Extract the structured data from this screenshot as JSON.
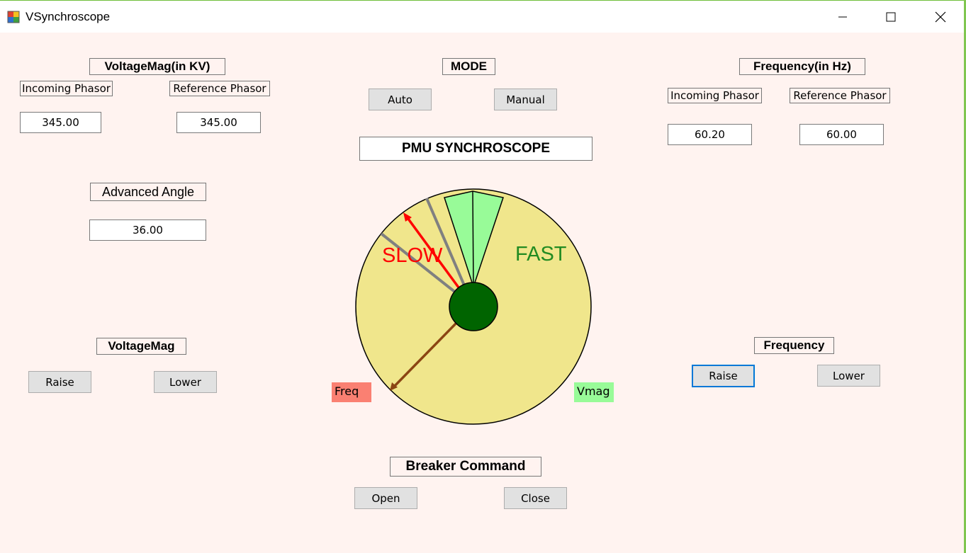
{
  "window": {
    "title": "VSynchroscope"
  },
  "voltage_mag_group": {
    "title": "VoltageMag(in KV)",
    "incoming_label": "Incoming Phasor",
    "reference_label": "Reference Phasor",
    "incoming_value": "345.00",
    "reference_value": "345.00"
  },
  "advanced_angle": {
    "label": "Advanced Angle",
    "value": "36.00"
  },
  "mode": {
    "title": "MODE",
    "auto_label": "Auto",
    "manual_label": "Manual"
  },
  "scope": {
    "title": "PMU SYNCHROSCOPE",
    "slow_label": "SLOW",
    "fast_label": "FAST",
    "freq_label": "Freq",
    "vmag_label": "Vmag",
    "colors": {
      "dial": "#f0e68c",
      "sync_window": "#98fb98",
      "hub": "#006400",
      "slow": "#ff0000",
      "fast": "#228b22",
      "freq_badge": "#fa8072",
      "vmag_badge": "#98fb98",
      "pointer": "#8b4513"
    }
  },
  "frequency_group": {
    "title": "Frequency(in Hz)",
    "incoming_label": "Incoming Phasor",
    "reference_label": "Reference Phasor",
    "incoming_value": "60.20",
    "reference_value": "60.00"
  },
  "voltage_control": {
    "title": "VoltageMag",
    "raise_label": "Raise",
    "lower_label": "Lower"
  },
  "frequency_control": {
    "title": "Frequency",
    "raise_label": "Raise",
    "lower_label": "Lower"
  },
  "breaker": {
    "title": "Breaker Command",
    "open_label": "Open",
    "close_label": "Close"
  }
}
